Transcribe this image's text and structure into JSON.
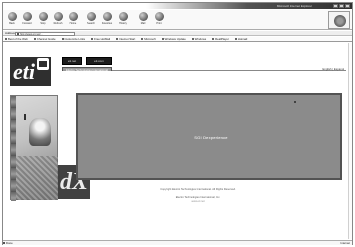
{
  "window": {
    "title": "Microsoft Internet Explorer"
  },
  "toolbar": {
    "buttons": [
      {
        "label": "Back",
        "icon": "back-arrow-icon"
      },
      {
        "label": "Forward",
        "icon": "forward-arrow-icon"
      },
      {
        "label": "Stop",
        "icon": "stop-icon"
      },
      {
        "label": "Refresh",
        "icon": "refresh-icon"
      },
      {
        "label": "Home",
        "icon": "home-icon"
      },
      {
        "label": "Search",
        "icon": "search-icon"
      },
      {
        "label": "Favorites",
        "icon": "favorites-icon"
      },
      {
        "label": "History",
        "icon": "history-icon"
      },
      {
        "label": "Mail",
        "icon": "mail-icon"
      },
      {
        "label": "Print",
        "icon": "print-icon"
      }
    ]
  },
  "address": {
    "label": "Address",
    "value": "http://www.eti.net/..."
  },
  "links": {
    "items": [
      "Best of the Web",
      "Channel Guide",
      "Customize Links",
      "Free HotMail",
      "Internet Start",
      "Microsoft",
      "Windows Update",
      "Windows",
      "RealPlayer",
      "Hotmail"
    ]
  },
  "site": {
    "logo_text": "eti",
    "nav_a": "eti.net",
    "nav_b": "eti.com",
    "tab": "Electro Technologies International",
    "tab_right": "English | Espanol",
    "panel_label": "SGI Dexperience",
    "footer1": "Copyright Electro Technologies International. All Rights Reserved.",
    "footer2": "Electro Technologies International, Inc.",
    "footer3": "www.eti.net"
  },
  "status": {
    "text": "Done",
    "zone": "Internet"
  }
}
